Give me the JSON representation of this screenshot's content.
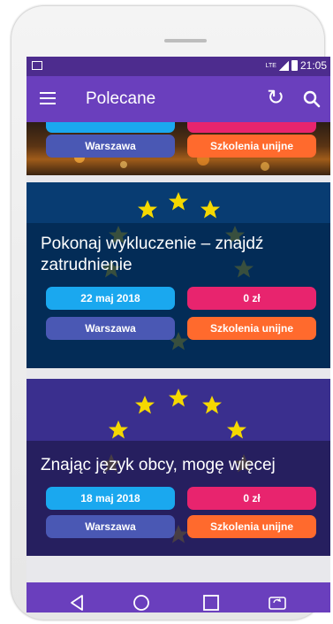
{
  "app": {
    "title": "Polecane",
    "status_time": "21:05",
    "status_network": "LTE"
  },
  "icons": {
    "menu": "menu-icon",
    "refresh": "refresh-icon",
    "search": "search-icon",
    "back": "back-icon",
    "home": "home-icon",
    "recents": "recents-icon",
    "rotate": "rotate-icon"
  },
  "colors": {
    "appbar": "#6a3fbd",
    "statusbar": "#4d2c8e",
    "date_pill": "#1aa8ef",
    "price_pill": "#e8246e",
    "city_pill": "#4a58b4",
    "category_pill": "#ff6a2d",
    "eu_star": "#f5d800"
  },
  "cards": [
    {
      "title": "",
      "city": "Warszawa",
      "category": "Szkolenia unijne"
    },
    {
      "title": "Pokonaj wykluczenie – znajdź zatrudnienie",
      "date": "22 maj 2018",
      "price": "0 zł",
      "city": "Warszawa",
      "category": "Szkolenia unijne"
    },
    {
      "title": "Znając język obcy, mogę więcej",
      "date": "18 maj 2018",
      "price": "0 zł",
      "city": "Warszawa",
      "category": "Szkolenia unijne"
    }
  ]
}
